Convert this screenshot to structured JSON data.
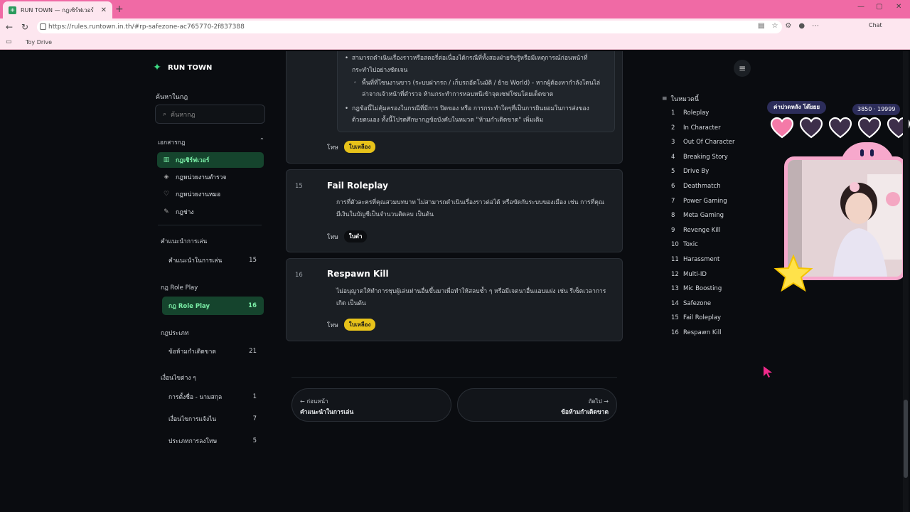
{
  "browser": {
    "tab_title": "RUN TOWN — กฎเซิร์ฟเวอร์",
    "tab_close": "✕",
    "new_tab": "+",
    "url": "https://rules.runtown.in.th/#rp-safezone-ac765770-2f837388",
    "chat_label": "Chat",
    "bookmark": "Toy Drive"
  },
  "header": {
    "brand": "RUN TOWN"
  },
  "sidebar": {
    "search_title": "ค้นหาในกฎ",
    "search_placeholder": "ค้นหากฎ",
    "docs_title": "เอกสารกฎ",
    "docs_toggle": "⌃",
    "docs": [
      {
        "label": "กฎเซิร์ฟเวอร์",
        "icon": "book-icon",
        "active": true
      },
      {
        "label": "กฎหน่วยงานตำรวจ",
        "icon": "shield-icon",
        "active": false
      },
      {
        "label": "กฎหน่วยงานหมอ",
        "icon": "heart-icon",
        "active": false
      },
      {
        "label": "กฎช่าง",
        "icon": "wrench-icon",
        "active": false
      }
    ],
    "groups": [
      {
        "title": "คำแนะนำการเล่น",
        "rows": [
          {
            "label": "คำแนะนำในการเล่น",
            "count": "15",
            "active": false
          }
        ]
      },
      {
        "title": "กฎ Role Play",
        "rows": [
          {
            "label": "กฎ Role Play",
            "count": "16",
            "active": true
          }
        ]
      },
      {
        "title": "กฎประเภท",
        "rows": [
          {
            "label": "ข้อห้ามกำเดิดขาด",
            "count": "21",
            "active": false
          }
        ]
      },
      {
        "title": "เงื่อนไขต่าง ๆ",
        "rows": [
          {
            "label": "การตั้งชื่อ - นามสกุล",
            "count": "1",
            "active": false
          },
          {
            "label": "เงื่อนไขการแจ้งไน",
            "count": "7",
            "active": false
          },
          {
            "label": "ประเภทการลงโทษ",
            "count": "5",
            "active": false
          }
        ]
      }
    ]
  },
  "main": {
    "prev_card": {
      "bullets": [
        "สามารถดำเนินเรื่องราวหรือสตอรี่ต่อเนื่องได้กรณีที่ทั้งสองฝ่ายรับรู้หรือมีเหตุการณ์ก่อนหน้าที่",
        "กระทำไปอย่างชัดเจน",
        "พื้นที่ที่โซนงานขาว (ระบบฝากรถ / เก็บรถอัตโนมัติ / ย้าย World) - หากผู้ต้องหากำลังโดนไล่",
        "ล่าจากเจ้าหน้าที่ตำรวจ ห้ามกระทำการหลบหนีเข้าจุดเซฟโซนโดยเด็ดขาด",
        "กฎข้อนี้ไม่คุ้มครองในกรณีที่มีการ ปิดของ หรือ การกระทำใดๆที่เป็นการยินยอมในการส่งของ",
        "ด้วยตนเอง ทั้งนี้โปรดศึกษากฎข้อบังคับในหมวด \"ห้ามกำเดิดขาด\" เพิ่มเติม"
      ],
      "penalty_label": "โทษ",
      "penalty": "ใบเหลือง"
    },
    "rules": [
      {
        "num": "15",
        "title": "Fail Roleplay",
        "desc1": "การที่ตัวละครที่คุณสวมบทบาท ไม่สามารถดำเนินเรื่องราวต่อได้ หรือขัดกับระบบของเมือง เช่น การที่คุณ",
        "desc2": "มีเงินในบัญชีเป็นจำนวนติดลบ เป็นต้น",
        "penalty_label": "โทษ",
        "penalty": "ใบดำ"
      },
      {
        "num": "16",
        "title": "Respawn Kill",
        "desc1": "ไม่อนุญาตให้ทำการชุบผู้เล่นท่านอื่นขึ้นมาเพื่อทำให้สลบซ้ำ ๆ หรือมีเจตนาอื่นแอบแฝง เช่น รีเซ็ตเวลาการ",
        "desc2": "เกิด เป็นต้น",
        "penalty_label": "โทษ",
        "penalty": "ใบเหลือง"
      }
    ],
    "pager": {
      "prev_hint": "← ก่อนหน้า",
      "prev_label": "คำแนะนำในการเล่น",
      "next_hint": "ถัดไป →",
      "next_label": "ข้อห้ามกำเดิดขาด"
    }
  },
  "toc": {
    "title": "ในหมวดนี้",
    "items": [
      {
        "n": "1",
        "label": "Roleplay"
      },
      {
        "n": "2",
        "label": "In Character"
      },
      {
        "n": "3",
        "label": "Out Of Character"
      },
      {
        "n": "4",
        "label": "Breaking Story"
      },
      {
        "n": "5",
        "label": "Drive By"
      },
      {
        "n": "6",
        "label": "Deathmatch"
      },
      {
        "n": "7",
        "label": "Power Gaming"
      },
      {
        "n": "8",
        "label": "Meta Gaming"
      },
      {
        "n": "9",
        "label": "Revenge Kill"
      },
      {
        "n": "10",
        "label": "Toxic"
      },
      {
        "n": "11",
        "label": "Harassment"
      },
      {
        "n": "12",
        "label": "Multi-ID"
      },
      {
        "n": "13",
        "label": "Mic Boosting"
      },
      {
        "n": "14",
        "label": "Safezone"
      },
      {
        "n": "15",
        "label": "Fail Roleplay"
      },
      {
        "n": "16",
        "label": "Respawn Kill"
      }
    ]
  },
  "overlay": {
    "label": "ค่าปวดหลัง โต๊ยยย",
    "counter": "3850 · 19999",
    "hearts_filled": 1,
    "hearts_total": 5
  },
  "colors": {
    "accent": "#3ddc84",
    "tabbar": "#f06aa5",
    "badge_yellow": "#e7c21a"
  }
}
